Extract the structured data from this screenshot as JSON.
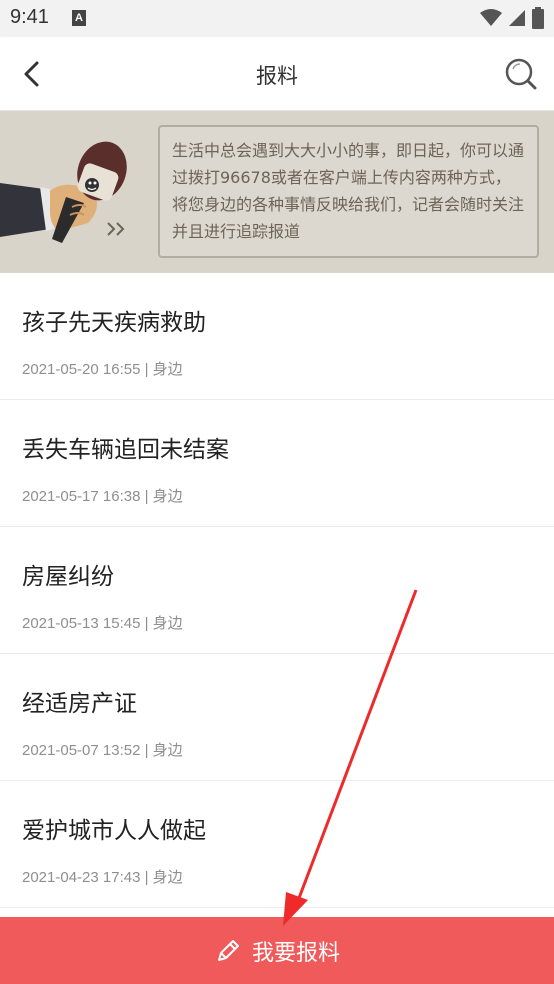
{
  "status_bar": {
    "time": "9:41",
    "notification_letter": "A"
  },
  "header": {
    "title": "报料"
  },
  "banner": {
    "text": "生活中总会遇到大大小小的事，即日起，你可以通过拨打96678或者在客户端上传内容两种方式，将您身边的各种事情反映给我们，记者会随时关注并且进行追踪报道"
  },
  "news": [
    {
      "title": "孩子先天疾病救助",
      "meta": "2021-05-20 16:55 | 身边"
    },
    {
      "title": "丢失车辆追回未结案",
      "meta": "2021-05-17 16:38 | 身边"
    },
    {
      "title": "房屋纠纷",
      "meta": "2021-05-13 15:45 | 身边"
    },
    {
      "title": "经适房产证",
      "meta": "2021-05-07 13:52 | 身边"
    },
    {
      "title": "爱护城市人人做起",
      "meta": "2021-04-23 17:43 | 身边"
    }
  ],
  "footer": {
    "report_label": "我要报料"
  },
  "colors": {
    "accent": "#f05a5a",
    "banner_bg": "#d8d4ca",
    "annotation": "#ee2a2a"
  },
  "icons": {
    "back": "chevron-left-icon",
    "search": "search-icon",
    "pencil": "pencil-icon"
  }
}
